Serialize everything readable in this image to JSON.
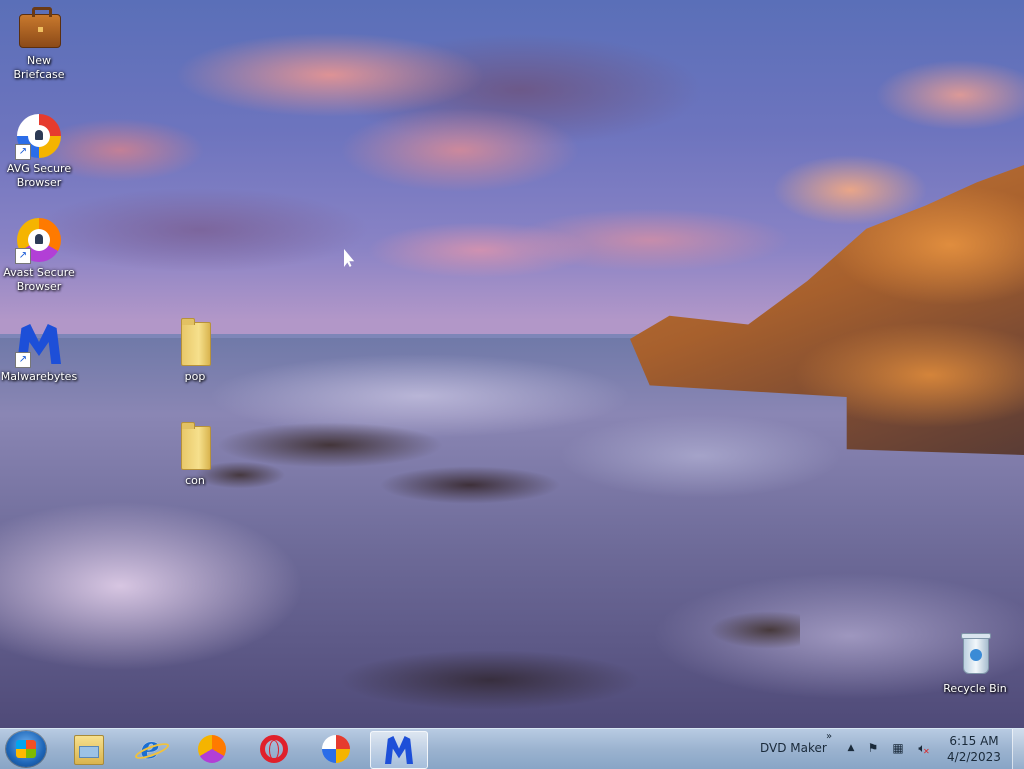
{
  "desktop": {
    "icons": [
      {
        "label": "New Briefcase"
      },
      {
        "label": "AVG Secure Browser"
      },
      {
        "label": "Avast Secure Browser"
      },
      {
        "label": "Malwarebytes"
      },
      {
        "label": "pop"
      },
      {
        "label": "con"
      },
      {
        "label": "Recycle Bin"
      }
    ]
  },
  "taskbar": {
    "pinned": [
      {
        "icon": "windows-explorer-icon"
      },
      {
        "icon": "internet-explorer-icon"
      },
      {
        "icon": "avast-secure-browser-icon"
      },
      {
        "icon": "opera-icon"
      },
      {
        "icon": "avg-secure-browser-icon"
      },
      {
        "icon": "malwarebytes-icon",
        "active": true
      }
    ],
    "toolbar_label": "DVD Maker",
    "toolbar_chevron": "»",
    "tray_overflow": "▲",
    "clock_time": "6:15 AM",
    "clock_date": "4/2/2023"
  }
}
